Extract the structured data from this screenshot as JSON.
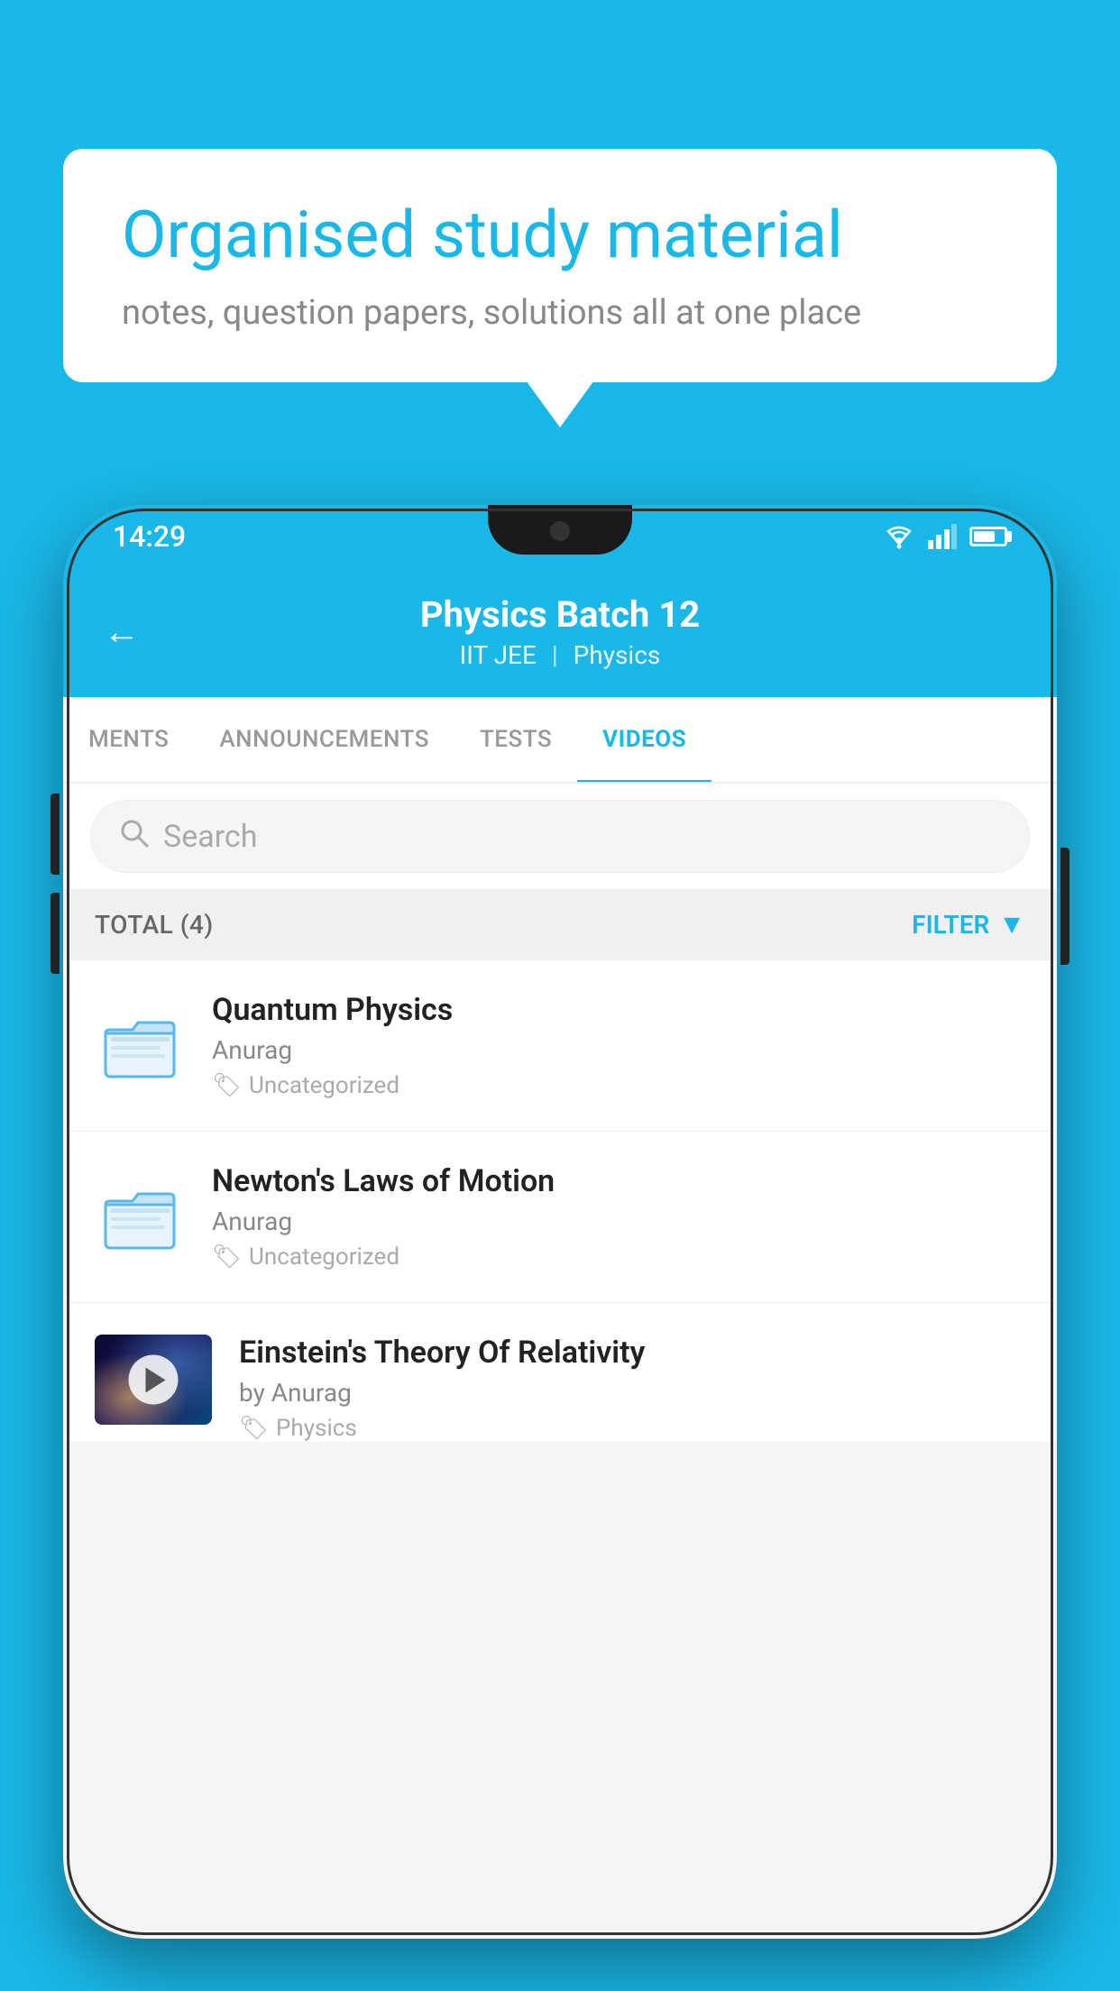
{
  "background_color": "#1ab8e8",
  "bubble": {
    "title": "Organised study material",
    "subtitle": "notes, question papers, solutions all at one place"
  },
  "status_bar": {
    "time": "14:29",
    "wifi": "wifi-icon",
    "signal": "signal-icon",
    "battery": "battery-icon"
  },
  "header": {
    "back_label": "←",
    "title": "Physics Batch 12",
    "tag1": "IIT JEE",
    "tag2": "Physics"
  },
  "tabs": [
    {
      "label": "MENTS",
      "active": false
    },
    {
      "label": "ANNOUNCEMENTS",
      "active": false
    },
    {
      "label": "TESTS",
      "active": false
    },
    {
      "label": "VIDEOS",
      "active": true
    }
  ],
  "search": {
    "placeholder": "Search"
  },
  "filter_bar": {
    "total_label": "TOTAL (4)",
    "filter_label": "FILTER"
  },
  "videos": [
    {
      "id": 1,
      "title": "Quantum Physics",
      "author": "Anurag",
      "tag": "Uncategorized",
      "type": "folder",
      "has_thumbnail": false
    },
    {
      "id": 2,
      "title": "Newton's Laws of Motion",
      "author": "Anurag",
      "tag": "Uncategorized",
      "type": "folder",
      "has_thumbnail": false
    },
    {
      "id": 3,
      "title": "Einstein's Theory Of Relativity",
      "author": "by Anurag",
      "tag": "Physics",
      "type": "video",
      "has_thumbnail": true
    }
  ]
}
